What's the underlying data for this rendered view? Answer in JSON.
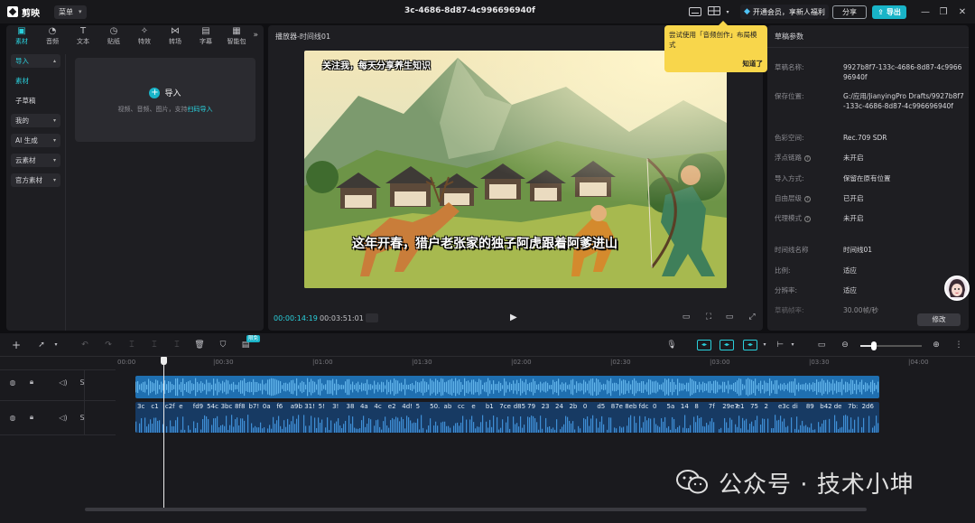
{
  "titlebar": {
    "app_name": "剪映",
    "menu_label": "菜单",
    "project_title": "3c-4686-8d87-4c996696940f",
    "vip_label": "开通会员，享新人福利",
    "share_label": "分享",
    "export_label": "导出"
  },
  "tool_tabs": [
    {
      "label": "素材",
      "icon": "media-icon",
      "active": true
    },
    {
      "label": "音频",
      "icon": "audio-icon",
      "active": false
    },
    {
      "label": "文本",
      "icon": "text-icon",
      "active": false
    },
    {
      "label": "贴纸",
      "icon": "sticker-icon",
      "active": false
    },
    {
      "label": "特效",
      "icon": "effects-icon",
      "active": false
    },
    {
      "label": "转场",
      "icon": "transition-icon",
      "active": false
    },
    {
      "label": "字幕",
      "icon": "subtitle-icon",
      "active": false
    },
    {
      "label": "智能包",
      "icon": "smart-pack-icon",
      "active": false
    }
  ],
  "side_nav": [
    {
      "label": "导入",
      "arrow": "▴"
    },
    {
      "label": "素材",
      "arrow": ""
    },
    {
      "label": "子草稿",
      "arrow": ""
    },
    {
      "label": "我的",
      "arrow": "▾"
    },
    {
      "label": "AI 生成",
      "arrow": "▾"
    },
    {
      "label": "云素材",
      "arrow": "▾"
    },
    {
      "label": "官方素材",
      "arrow": "▾"
    }
  ],
  "import_area": {
    "title": "导入",
    "hint": "视频、音频、图片，支持",
    "hint_link": "扫码导入"
  },
  "player": {
    "title": "播放器-时间线01",
    "subtitle_top": "关注我，每天分享养生知识",
    "subtitle_main": "这年开春，猎户老张家的独子阿虎跟着阿爹进山",
    "time_current": "00:00:14:19",
    "time_total": "00:03:51:01"
  },
  "tooltip": {
    "text": "尝试使用「音频创作」布局模式",
    "button": "知道了"
  },
  "props": {
    "title": "草稿参数",
    "rows": [
      {
        "label": "草稿名称:",
        "value": "9927b8f7-133c-4686-8d87-4c996696940f",
        "help": false
      },
      {
        "label": "保存位置:",
        "value": "G:/应用/JianyingPro Drafts/9927b8f7-133c-4686-8d87-4c996696940f",
        "help": false
      },
      {
        "label": "色彩空间:",
        "value": "Rec.709 SDR",
        "help": false
      },
      {
        "label": "浮点链路",
        "value": "未开启",
        "help": true
      },
      {
        "label": "导入方式:",
        "value": "保留在原有位置",
        "help": false
      },
      {
        "label": "自由层级",
        "value": "已开启",
        "help": true
      },
      {
        "label": "代理模式",
        "value": "未开启",
        "help": true
      },
      {
        "label": "时间线名称",
        "value": "时间线01",
        "help": false
      },
      {
        "label": "比例:",
        "value": "适应",
        "help": false
      },
      {
        "label": "分辨率:",
        "value": "适应",
        "help": false
      },
      {
        "label": "草稿帧率:",
        "value": "30.00帧/秒",
        "help": false
      }
    ],
    "edit_label": "修改"
  },
  "timeline": {
    "free_badge": "限免",
    "zoom_level": 0.22,
    "ruler_labels": [
      "00:00",
      "|00:30",
      "|01:00",
      "|01:30",
      "|02:00",
      "|02:30",
      "|03:00",
      "|03:30",
      "|04:00"
    ],
    "track1_head": [
      "audio-track-icon",
      "lock-icon",
      "speaker-icon",
      "S"
    ],
    "track2_head": [
      "audio-track-icon",
      "lock-icon",
      "speaker-icon",
      "S"
    ],
    "audio2_labels": [
      "3c",
      "c1",
      "c2f",
      "e",
      "fd9",
      "54c",
      "3bc",
      "8f8",
      "b7!",
      "0a",
      "f6",
      "a9b",
      "31!",
      "5!",
      "3!",
      "38",
      "4a",
      "4c",
      "e2",
      "4d!",
      "5",
      "50.",
      "ab",
      "cc",
      "e",
      "b1",
      "7ce",
      "d85",
      "79",
      "23",
      "24",
      "2b",
      "0",
      "d5",
      "87e",
      "8eb",
      "fdc",
      "0",
      "5a",
      "14",
      "8",
      "7f",
      "29e7",
      "e1",
      "75",
      "2",
      "e3c",
      "di",
      "89",
      "b42",
      "de",
      "7b:",
      "2d6"
    ]
  },
  "watermark": "公众号 · 技术小坤"
}
